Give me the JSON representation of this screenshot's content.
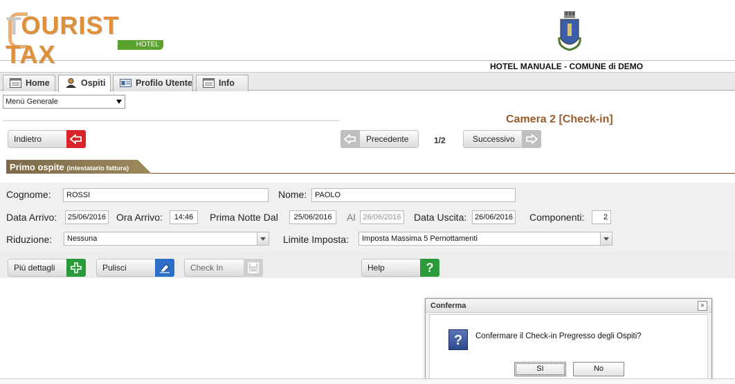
{
  "header": {
    "logo_main": "OURIST TAX",
    "logo_first": "T",
    "logo_sub": "HOTEL",
    "title": "HOTEL MANUALE - COMUNE di DEMO"
  },
  "tabs": [
    {
      "label": "Home",
      "icon": "window-icon"
    },
    {
      "label": "Ospiti",
      "icon": "user-icon"
    },
    {
      "label": "Profilo Utente",
      "icon": "id-card-icon"
    },
    {
      "label": "Info",
      "icon": "window-icon"
    }
  ],
  "menu": {
    "selected": "Menù Generale"
  },
  "room": {
    "title": "Camera 2 [Check-in]"
  },
  "nav": {
    "back_label": "Indietro",
    "prev_label": "Precedente",
    "page": "1/2",
    "next_label": "Successivo"
  },
  "section": {
    "title": "Primo ospite",
    "subtitle": "(intestatario fattura)"
  },
  "form": {
    "cognome_label": "Cognome:",
    "cognome_value": "ROSSI",
    "nome_label": "Nome:",
    "nome_value": "PAOLO",
    "data_arrivo_label": "Data Arrivo:",
    "data_arrivo_value": "25/06/2016",
    "ora_arrivo_label": "Ora Arrivo:",
    "ora_arrivo_value": "14:46",
    "prima_notte_label": "Prima Notte Dal",
    "prima_notte_value": "25/06/2016",
    "al_label": "Al",
    "al_value": "26/06/2016",
    "data_uscita_label": "Data Uscita:",
    "data_uscita_value": "26/06/2016",
    "componenti_label": "Componenti:",
    "componenti_value": "2",
    "riduzione_label": "Riduzione:",
    "riduzione_value": "Nessuna",
    "limite_label": "Limite Imposta:",
    "limite_value": "Imposta Massima 5 Pernottamenti"
  },
  "actions": {
    "details_label": "Più dettagli",
    "clear_label": "Pulisci",
    "checkin_label": "Check In",
    "help_label": "Help"
  },
  "dialog": {
    "title": "Conferma",
    "close": "×",
    "message": "Confermare il Check-in Pregresso degli Ospiti?",
    "yes_label": "Sì",
    "no_label": "No",
    "icon": "question-icon"
  },
  "colors": {
    "accent": "#9a5b2a",
    "logo_orange": "#e0903a",
    "logo_green": "#5aa22e",
    "button_red": "#d9252a",
    "button_green": "#2a9a3a"
  }
}
